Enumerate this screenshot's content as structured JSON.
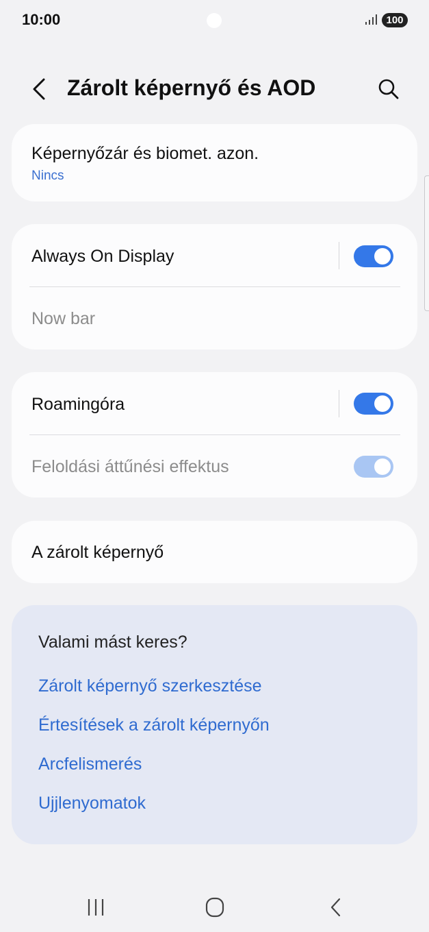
{
  "status": {
    "time": "10:00",
    "battery": "100"
  },
  "header": {
    "title": "Zárolt képernyő és AOD"
  },
  "cards": {
    "screen_lock": {
      "label": "Képernyőzár és biomet. azon.",
      "value": "Nincs"
    },
    "aod": {
      "label": "Always On Display",
      "toggle_on": true
    },
    "now_bar": {
      "label": "Now bar"
    },
    "roaming": {
      "label": "Roamingóra",
      "toggle_on": true
    },
    "unlock_effect": {
      "label": "Feloldási áttűnési effektus",
      "toggle_on": true,
      "enabled": false
    },
    "lock_screen": {
      "label": "A zárolt képernyő"
    }
  },
  "suggestions": {
    "title": "Valami mást keres?",
    "links": [
      "Zárolt képernyő szerkesztése",
      "Értesítések a zárolt képernyőn",
      "Arcfelismerés",
      "Ujjlenyomatok"
    ]
  },
  "colors": {
    "accent": "#3478e8",
    "link": "#2f6bd0",
    "background": "#f2f2f4",
    "suggest_bg": "#e4e8f4"
  }
}
